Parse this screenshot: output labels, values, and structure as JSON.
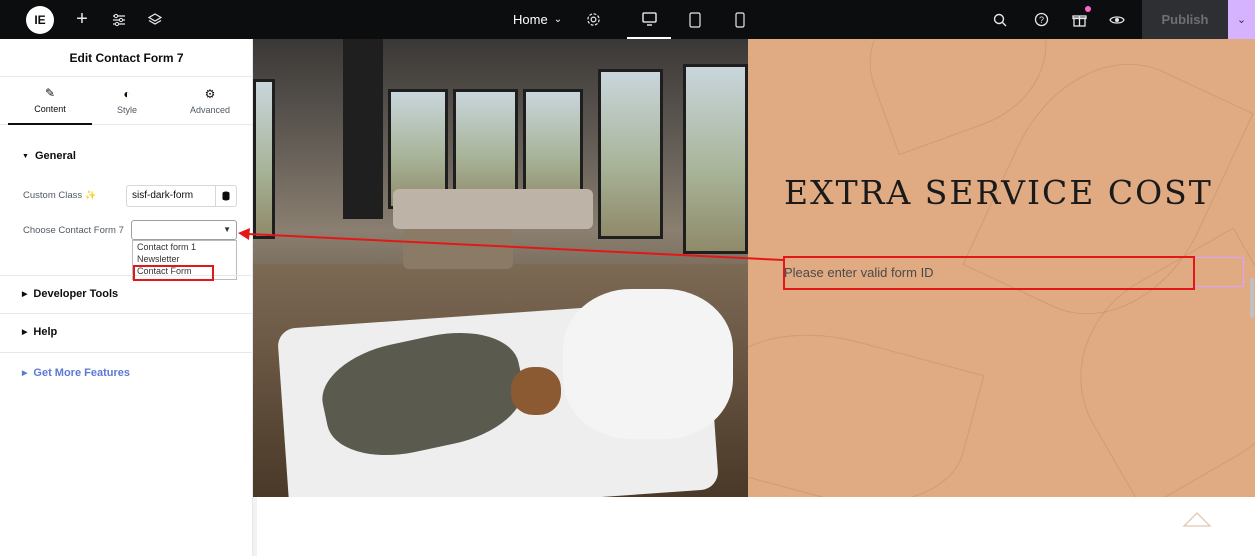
{
  "topbar": {
    "logo_text": "IE",
    "page_selector": "Home",
    "publish_label": "Publish",
    "icons": [
      "elementor-logo-icon",
      "plus-icon",
      "sliders-icon",
      "layers-icon",
      "settings-icon",
      "desktop-icon",
      "tablet-icon",
      "mobile-icon",
      "search-icon",
      "help-icon",
      "gift-icon",
      "eye-icon",
      "chevron-down-icon"
    ]
  },
  "panel": {
    "title": "Edit Contact Form 7",
    "tabs": [
      {
        "label": "Content",
        "icon": "pencil-icon",
        "active": true
      },
      {
        "label": "Style",
        "icon": "half-circle-icon",
        "active": false
      },
      {
        "label": "Advanced",
        "icon": "gear-icon",
        "active": false
      }
    ],
    "general": {
      "heading": "General",
      "custom_class_label": "Custom Class",
      "custom_class_value": "sisf-dark-form",
      "choose_form_label": "Choose Contact Form 7",
      "choose_form_value": "",
      "options": [
        "Contact form 1",
        "Newsletter",
        "Contact Form"
      ]
    },
    "developer_tools": "Developer Tools",
    "help": "Help",
    "more_features": "Get More Features"
  },
  "canvas": {
    "heading": "EXTRA SERVICE COST",
    "notice": "Please enter valid form ID"
  },
  "colors": {
    "topbar": "#0c0d0e",
    "publish_caret": "#d6b3ff",
    "section_bg": "#e0ab83",
    "accent_link": "#5d79d6",
    "annotation": "#e21818"
  }
}
